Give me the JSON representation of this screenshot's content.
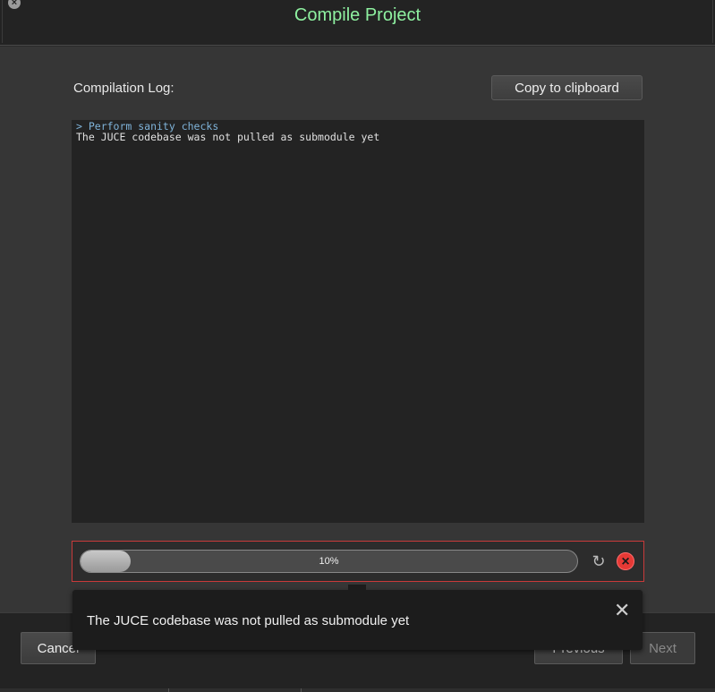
{
  "window": {
    "title": "Compile Project",
    "close_icon": "close-circle-icon"
  },
  "log": {
    "label": "Compilation Log:",
    "copy_button": "Copy to clipboard",
    "lines": [
      {
        "text": "> Perform sanity checks",
        "kind": "command"
      },
      {
        "text": "The JUCE codebase was not pulled as submodule yet",
        "kind": "message"
      }
    ]
  },
  "progress": {
    "value_percent": 10,
    "text": "10%",
    "refresh_icon": "refresh-icon",
    "stop_icon": "stop-icon"
  },
  "toast": {
    "message": "The JUCE codebase was not pulled as submodule yet",
    "close_icon": "close-icon"
  },
  "footer": {
    "cancel": "Cancel",
    "previous": "Previous",
    "next": "Next"
  },
  "colors": {
    "title": "#8ef0a0",
    "error_border": "#c83a3a",
    "stop": "#e53935"
  }
}
